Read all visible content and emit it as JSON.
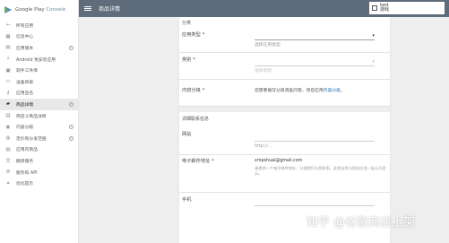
{
  "brand": {
    "name": "Google Play",
    "suffix": "Console"
  },
  "header": {
    "title": "商品详情"
  },
  "user": {
    "line1": "test",
    "line2": "游戏"
  },
  "sidebar": {
    "items": [
      {
        "label": "所有应用",
        "icon": "back-arrow-icon"
      },
      {
        "label": "信息中心",
        "icon": "dashboard-icon"
      },
      {
        "label": "应用版本",
        "icon": "release-icon",
        "warn": true
      },
      {
        "label": "Android 免安装应用",
        "icon": "instant-app-icon"
      },
      {
        "label": "软件工件库",
        "icon": "library-icon"
      },
      {
        "label": "设备目录",
        "icon": "device-icon"
      },
      {
        "label": "应用签名",
        "icon": "key-icon"
      },
      {
        "label": "商品详情",
        "icon": "store-icon",
        "active": true,
        "warn": true
      },
      {
        "label": "商店义商品详情",
        "icon": "custom-listing-icon"
      },
      {
        "label": "内容分级",
        "icon": "content-rating-icon",
        "warn": true
      },
      {
        "label": "定价和分发范围",
        "icon": "globe-icon",
        "warn": true
      },
      {
        "label": "应用内商品",
        "icon": "cart-icon"
      },
      {
        "label": "翻译服务",
        "icon": "translate-icon"
      },
      {
        "label": "服务和 API",
        "icon": "api-icon"
      },
      {
        "label": "优化提示",
        "icon": "lightbulb-icon"
      }
    ]
  },
  "categorization": {
    "title": "分类",
    "app_type_label": "应用类型",
    "app_type_placeholder": "选择应用类型",
    "category_label": "类别",
    "category_placeholder": "选择类别",
    "rating_label": "内容分级",
    "rating_text": "您需要填写分级调查问卷，然后应用",
    "rating_link": "内容分级",
    "rating_end": "。"
  },
  "contact": {
    "title": "详细联系信息",
    "website_label": "网站",
    "website_placeholder": "http://...",
    "email_label": "电子邮件地址",
    "email_value": "xmpshuai@gmail.com",
    "email_helper_1": "请提供一个电子邮件地址，以便我们与您联系。此地址将与您的应用一起公开显",
    "email_helper_2": "示。",
    "phone_label": "手机"
  },
  "watermark": {
    "text": "知乎 @谷歌商店上架"
  }
}
